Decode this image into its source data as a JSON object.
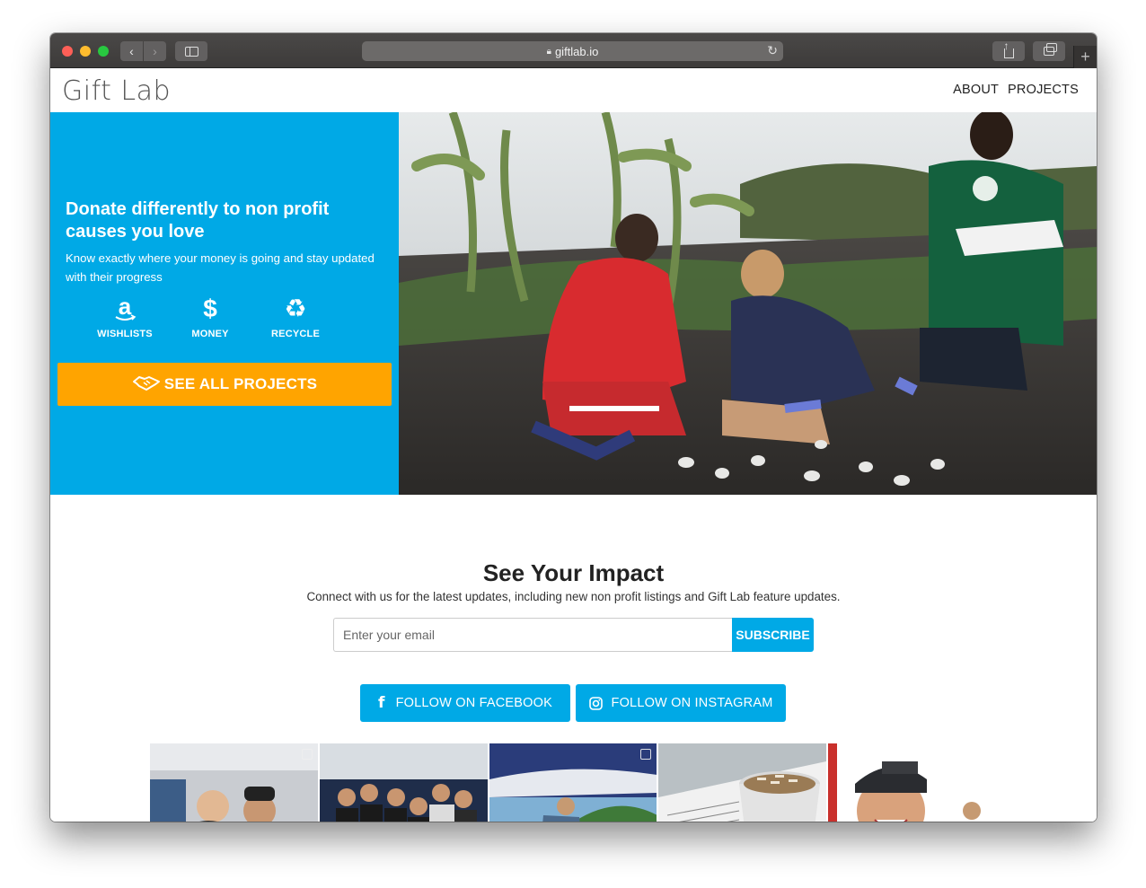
{
  "browser": {
    "url": "giftlab.io",
    "new_tab_symbol": "+"
  },
  "site": {
    "logo": "Gift Lab",
    "nav": [
      "ABOUT",
      "PROJECTS"
    ]
  },
  "hero": {
    "title": "Donate differently to non profit causes you love",
    "subtitle": "Know exactly where your money is going and stay updated with their progress",
    "features": [
      {
        "icon": "amazon-icon",
        "glyph": "a",
        "label": "WISHLISTS"
      },
      {
        "icon": "dollar-icon",
        "glyph": "$",
        "label": "MONEY"
      },
      {
        "icon": "recycle-icon",
        "glyph": "♻",
        "label": "RECYCLE"
      }
    ],
    "cta": "SEE ALL PROJECTS",
    "panel_color": "#00a9e6",
    "cta_color": "#ffa400"
  },
  "impact": {
    "title": "See Your Impact",
    "subtitle": "Connect with us for the latest updates, including new non profit listings and Gift Lab feature updates.",
    "email_placeholder": "Enter your email",
    "subscribe_label": "SUBSCRIBE",
    "follow_facebook": "FOLLOW ON FACEBOOK",
    "follow_instagram": "FOLLOW ON INSTAGRAM"
  },
  "gallery": {
    "images": [
      "instagram-photo-1",
      "instagram-photo-2",
      "instagram-photo-3",
      "instagram-photo-4",
      "instagram-photo-5"
    ]
  }
}
